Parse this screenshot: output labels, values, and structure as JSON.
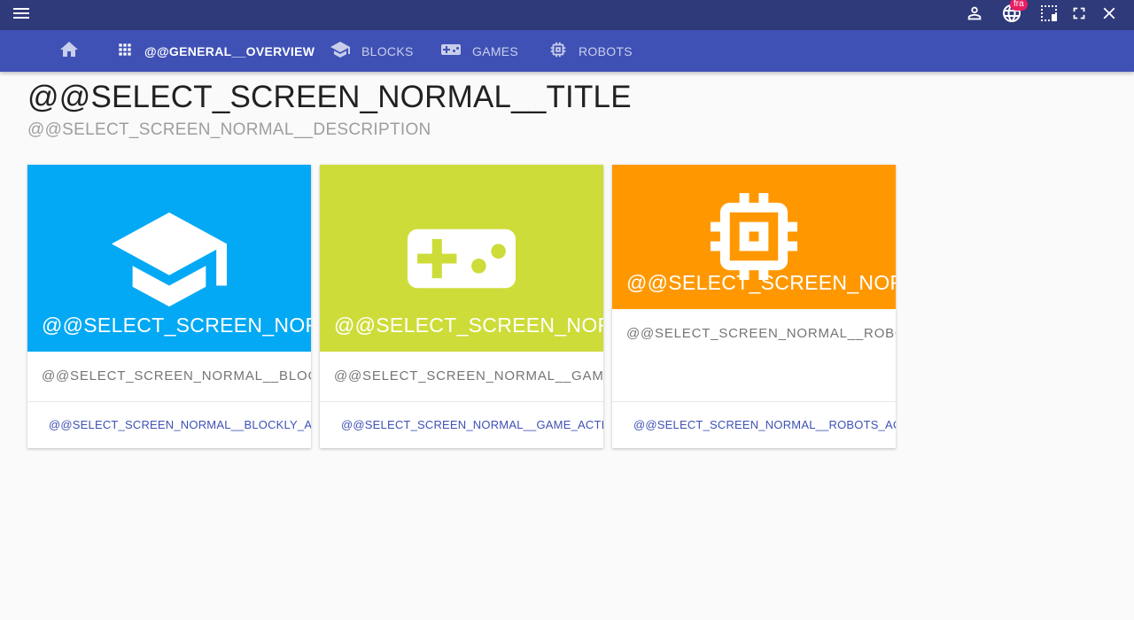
{
  "topbar": {
    "language_badge": "fra",
    "icons": [
      "menu-icon",
      "user-icon",
      "language-icon",
      "selection-icon",
      "fullscreen-icon",
      "close-icon"
    ]
  },
  "nav": {
    "items": [
      {
        "label": "",
        "icon": "home-icon"
      },
      {
        "label": "@@GENERAL__OVERVIEW",
        "icon": "apps-grid-icon",
        "active": true
      },
      {
        "label": "BLOCKS",
        "icon": "school-icon"
      },
      {
        "label": "GAMES",
        "icon": "gamepad-icon"
      },
      {
        "label": "ROBOTS",
        "icon": "chip-icon"
      }
    ]
  },
  "main": {
    "title": "@@SELECT_SCREEN_NORMAL__TITLE",
    "description": "@@SELECT_SCREEN_NORMAL__DESCRIPTION"
  },
  "cards": [
    {
      "title": "@@SELECT_SCREEN_NOR",
      "description": "@@SELECT_SCREEN_NORMAL__BLOCKLY_",
      "action": "@@SELECT_SCREEN_NORMAL__BLOCKLY_ACTION",
      "color": "#03a9f4",
      "icon": "school-icon"
    },
    {
      "title": "@@SELECT_SCREEN_NOR",
      "description": "@@SELECT_SCREEN_NORMAL__GAME_",
      "action": "@@SELECT_SCREEN_NORMAL__GAME_ACTION",
      "color": "#cddc39",
      "icon": "gamepad-icon"
    },
    {
      "title": "@@SELECT_SCREEN_NOR",
      "description": "@@SELECT_SCREEN_NORMAL__ROBOTS_",
      "action": "@@SELECT_SCREEN_NORMAL__ROBOTS_ACTION",
      "color": "#ff9800",
      "icon": "chip-icon"
    }
  ]
}
